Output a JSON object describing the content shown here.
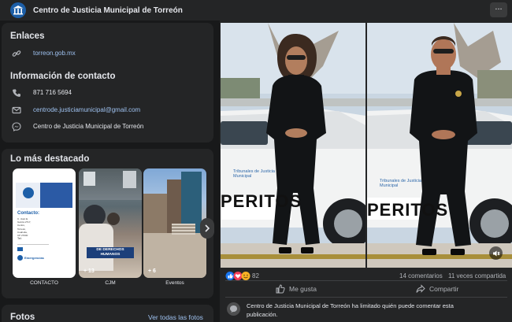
{
  "header": {
    "page_name": "Centro de Justicia Municipal de Torreón",
    "more_label": "..."
  },
  "links": {
    "title": "Enlaces",
    "website": "torreon.gob.mx"
  },
  "contact": {
    "title": "Información de contacto",
    "phone": "871 716 5694",
    "email": "centrode.justiciamunicipal@gmail.com",
    "page": "Centro de Justicia Municipal de Torreón"
  },
  "highlights": {
    "title": "Lo más destacado",
    "items": [
      {
        "label": "CONTACTO",
        "count": ""
      },
      {
        "label": "CJM",
        "count": "+ 13",
        "overlay": "DE DERECHOS\nHUMANOS"
      },
      {
        "label": "Eventos",
        "count": "+ 6"
      }
    ],
    "contact_card": {
      "heading": "Contacto:",
      "lines": [
        "C. Juan E.",
        "García 2717,",
        "Centro, Torreón,",
        "Coahuila,",
        "CP 27000"
      ],
      "tel_label": "Tel:",
      "emergencias": "Emergencias"
    }
  },
  "photos": {
    "title": "Fotos",
    "see_all": "Ver todas las fotos"
  },
  "post": {
    "images": [
      {
        "vehicle_text": "PERITOS",
        "logo_text": "Tribunales de Justicia Municipal"
      },
      {
        "vehicle_text": "PERITOS",
        "logo_text": "Tribunales de Justicia Municipal"
      }
    ],
    "reaction_count": "82",
    "comments": "14 comentarios",
    "shares": "11 veces compartida",
    "like_label": "Me gusta",
    "share_label": "Compartir",
    "notice": "Centro de Justicia Municipal de Torreón ha limitado quién puede comentar esta publicación."
  },
  "colors": {
    "background": "#18191a",
    "card": "#242526",
    "link": "#9ec1ef",
    "brand": "#1d5fa8"
  }
}
